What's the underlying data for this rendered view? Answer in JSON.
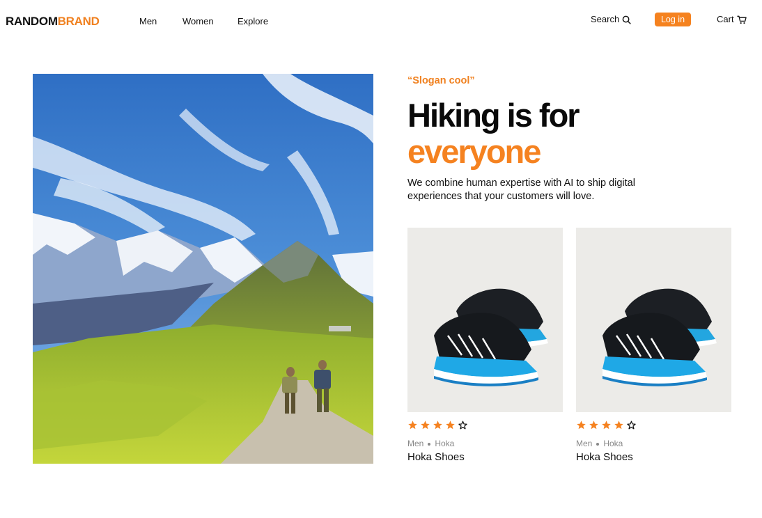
{
  "header": {
    "logo_part1": "RANDOM",
    "logo_part2": "BRAND",
    "nav": [
      "Men",
      "Women",
      "Explore"
    ],
    "search_label": "Search",
    "login_label": "Log in",
    "cart_label": "Cart"
  },
  "hero": {
    "slogan": "“Slogan cool”",
    "headline_line1": "Hiking is for",
    "headline_line2": "everyone",
    "description": "We combine human expertise with AI to ship digital experiences that your customers will love."
  },
  "products": [
    {
      "rating": 4,
      "max_rating": 5,
      "category": "Men",
      "brand": "Hoka",
      "name": "Hoka Shoes"
    },
    {
      "rating": 4,
      "max_rating": 5,
      "category": "Men",
      "brand": "Hoka",
      "name": "Hoka Shoes"
    }
  ],
  "colors": {
    "accent": "#f58220",
    "text": "#111111",
    "muted": "#888888"
  }
}
